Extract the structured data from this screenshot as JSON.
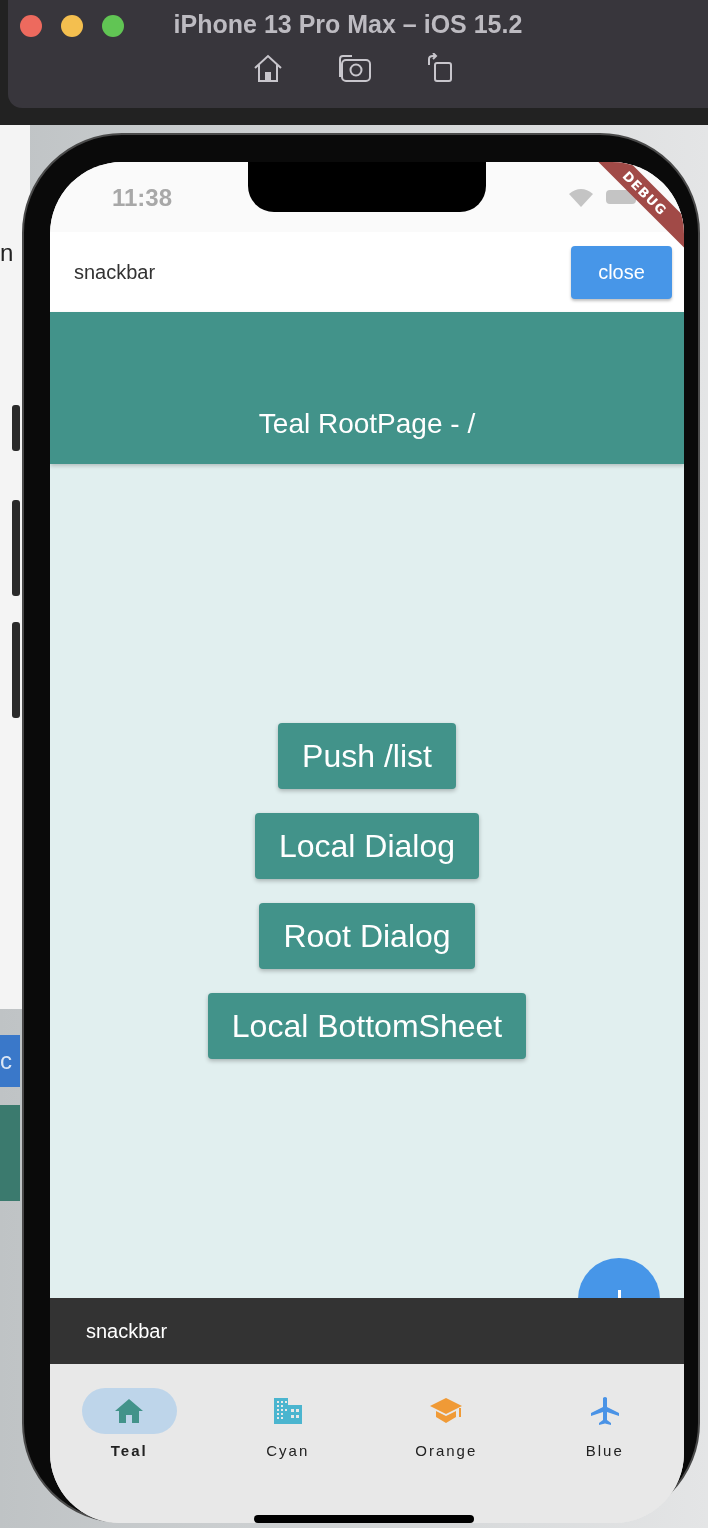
{
  "simulator": {
    "title": "iPhone 13 Pro Max – iOS 15.2"
  },
  "background_window": {
    "texts": [
      "n",
      "c"
    ]
  },
  "status_bar": {
    "time": "11:38"
  },
  "debug_banner": "DEBUG",
  "top_banner": {
    "message": "snackbar",
    "action": "close"
  },
  "app_bar": {
    "title": "Teal RootPage - /"
  },
  "buttons": [
    "Push /list",
    "Local Dialog",
    "Root Dialog",
    "Local BottomSheet"
  ],
  "snackbar": {
    "message": "snackbar"
  },
  "bottom_nav": [
    {
      "label": "Teal",
      "kind": "home",
      "color": "#42938a",
      "selected": true
    },
    {
      "label": "Cyan",
      "kind": "building",
      "color": "#4bb5cf",
      "selected": false
    },
    {
      "label": "Orange",
      "kind": "school",
      "color": "#f09a36",
      "selected": false
    },
    {
      "label": "Blue",
      "kind": "plane",
      "color": "#4a93e6",
      "selected": false
    }
  ]
}
